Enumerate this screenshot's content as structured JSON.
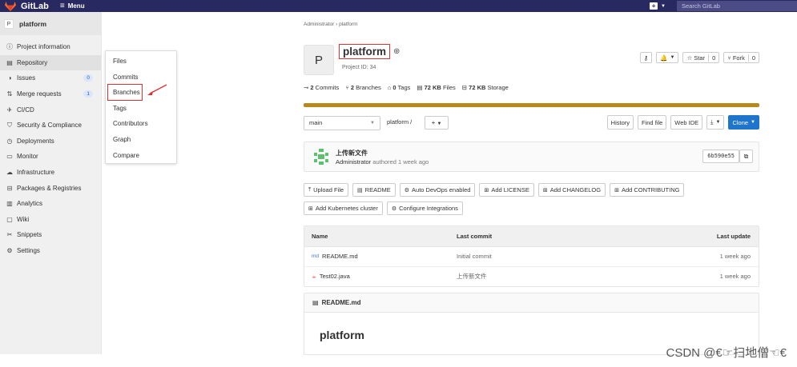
{
  "topbar": {
    "brand": "GitLab",
    "menu": "Menu",
    "plus": "+",
    "search_placeholder": "Search GitLab"
  },
  "sidebar": {
    "project_avatar": "P",
    "project_name": "platform",
    "items": [
      {
        "label": "Project information",
        "icon": "info-icon"
      },
      {
        "label": "Repository",
        "icon": "book-icon"
      },
      {
        "label": "Issues",
        "icon": "issues-icon",
        "badge": "0"
      },
      {
        "label": "Merge requests",
        "icon": "merge-icon",
        "badge": "1"
      },
      {
        "label": "CI/CD",
        "icon": "rocket-icon"
      },
      {
        "label": "Security & Compliance",
        "icon": "shield-icon"
      },
      {
        "label": "Deployments",
        "icon": "deployments-icon"
      },
      {
        "label": "Monitor",
        "icon": "monitor-icon"
      },
      {
        "label": "Infrastructure",
        "icon": "cloud-icon"
      },
      {
        "label": "Packages & Registries",
        "icon": "package-icon"
      },
      {
        "label": "Analytics",
        "icon": "chart-icon"
      },
      {
        "label": "Wiki",
        "icon": "wiki-icon"
      },
      {
        "label": "Snippets",
        "icon": "scissors-icon"
      },
      {
        "label": "Settings",
        "icon": "gear-icon"
      }
    ]
  },
  "flyout": {
    "items": [
      "Files",
      "Commits",
      "Branches",
      "Tags",
      "Contributors",
      "Graph",
      "Compare"
    ]
  },
  "breadcrumb": {
    "root": "Administrator",
    "sep": "›",
    "current": "platform"
  },
  "project": {
    "avatar": "P",
    "title": "platform",
    "id_text": "Project ID: 34",
    "notify": "🔔",
    "star_label": "Star",
    "star_count": "0",
    "fork_label": "Fork",
    "fork_count": "0",
    "stats": [
      {
        "num": "2",
        "label": "Commits"
      },
      {
        "num": "2",
        "label": "Branches"
      },
      {
        "num": "0",
        "label": "Tags"
      },
      {
        "num": "72 KB",
        "label": "Files"
      },
      {
        "num": "72 KB",
        "label": "Storage"
      }
    ]
  },
  "toolbar": {
    "branch": "main",
    "path": "platform /",
    "plus": "+",
    "history": "History",
    "find_file": "Find file",
    "web_ide": "Web IDE",
    "download": "⤓",
    "clone": "Clone"
  },
  "commit": {
    "title": "上传新文件",
    "author": "Administrator",
    "meta": " authored 1 week ago",
    "sha": "6b590e55"
  },
  "quick_actions": [
    {
      "label": "Upload File",
      "icon": "upload-icon",
      "glyph": "⤒"
    },
    {
      "label": "README",
      "icon": "doc-icon",
      "glyph": "▤"
    },
    {
      "label": "Auto DevOps enabled",
      "icon": "gear-icon",
      "glyph": "⚙"
    },
    {
      "label": "Add LICENSE",
      "icon": "plus-square-icon",
      "glyph": "⊞"
    },
    {
      "label": "Add CHANGELOG",
      "icon": "plus-square-icon",
      "glyph": "⊞"
    },
    {
      "label": "Add CONTRIBUTING",
      "icon": "plus-square-icon",
      "glyph": "⊞"
    },
    {
      "label": "Add Kubernetes cluster",
      "icon": "plus-square-icon",
      "glyph": "⊞"
    },
    {
      "label": "Configure Integrations",
      "icon": "gear-icon",
      "glyph": "⚙"
    }
  ],
  "files": {
    "headers": {
      "name": "Name",
      "commit": "Last commit",
      "update": "Last update"
    },
    "rows": [
      {
        "name": "README.md",
        "icon": "markdown-icon",
        "glyph": "md",
        "commit": "Initial commit",
        "update": "1 week ago"
      },
      {
        "name": "Test02.java",
        "icon": "java-icon",
        "glyph": "☕",
        "commit": "上传新文件",
        "update": "1 week ago"
      }
    ]
  },
  "readme": {
    "file": "README.md",
    "heading": "platform"
  },
  "watermark": "CSDN @€☞扫地僧☜€"
}
